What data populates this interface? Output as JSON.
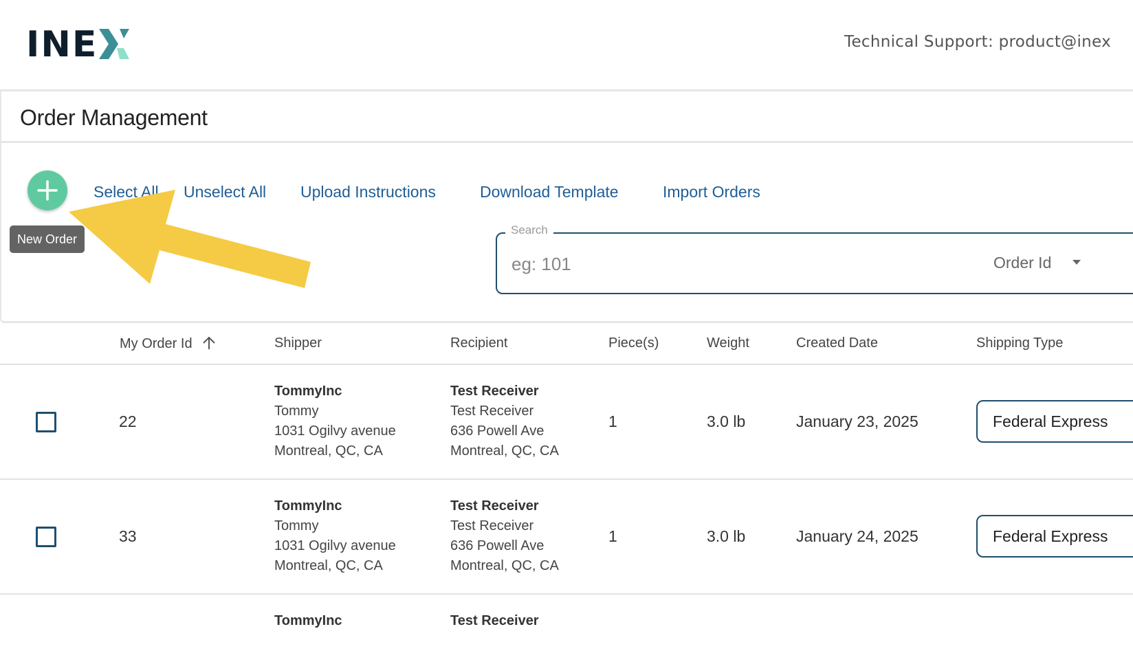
{
  "header": {
    "logo": "INEX",
    "support_text": "Technical Support: product@inex"
  },
  "page": {
    "title": "Order Management"
  },
  "toolbar": {
    "new_order_tooltip": "New Order",
    "select_all": "Select All",
    "unselect_all": "Unselect All",
    "upload_instructions": "Upload Instructions",
    "download_template": "Download Template",
    "import_orders": "Import Orders"
  },
  "search": {
    "label": "Search",
    "placeholder": "eg: 101",
    "value": "",
    "field": "Order Id"
  },
  "table": {
    "columns": [
      "My Order Id",
      "Shipper",
      "Recipient",
      "Piece(s)",
      "Weight",
      "Created Date",
      "Shipping Type"
    ],
    "sort": {
      "column": "My Order Id",
      "direction": "ascending"
    },
    "rows": [
      {
        "id": "22",
        "shipper": {
          "company": "TommyInc",
          "name": "Tommy",
          "street": "1031 Ogilvy avenue",
          "city": "Montreal, QC, CA"
        },
        "recipient": {
          "company": "Test Receiver",
          "name": "Test Receiver",
          "street": "636 Powell Ave",
          "city": "Montreal, QC, CA"
        },
        "pieces": "1",
        "weight": "3.0 lb",
        "created": "January 23, 2025",
        "shipping_type": "Federal Express"
      },
      {
        "id": "33",
        "shipper": {
          "company": "TommyInc",
          "name": "Tommy",
          "street": "1031 Ogilvy avenue",
          "city": "Montreal, QC, CA"
        },
        "recipient": {
          "company": "Test Receiver",
          "name": "Test Receiver",
          "street": "636 Powell Ave",
          "city": "Montreal, QC, CA"
        },
        "pieces": "1",
        "weight": "3.0 lb",
        "created": "January 24, 2025",
        "shipping_type": "Federal Express"
      },
      {
        "shipper": {
          "company": "TommyInc"
        },
        "recipient": {
          "company": "Test Receiver"
        }
      }
    ]
  },
  "colors": {
    "link": "#1f5e96",
    "fab": "#5fcaa0",
    "border_accent": "#1f4e6e",
    "annotation_arrow": "#f5cb45",
    "logo_dark": "#0f1e2c",
    "logo_x_teal": "#3b8f97",
    "logo_x_mint": "#8fe0c8"
  },
  "icons": {
    "fab": "plus-icon",
    "sort": "arrow-up-icon",
    "select": "chevron-down-icon",
    "annotation": "yellow-arrow-pointer"
  }
}
